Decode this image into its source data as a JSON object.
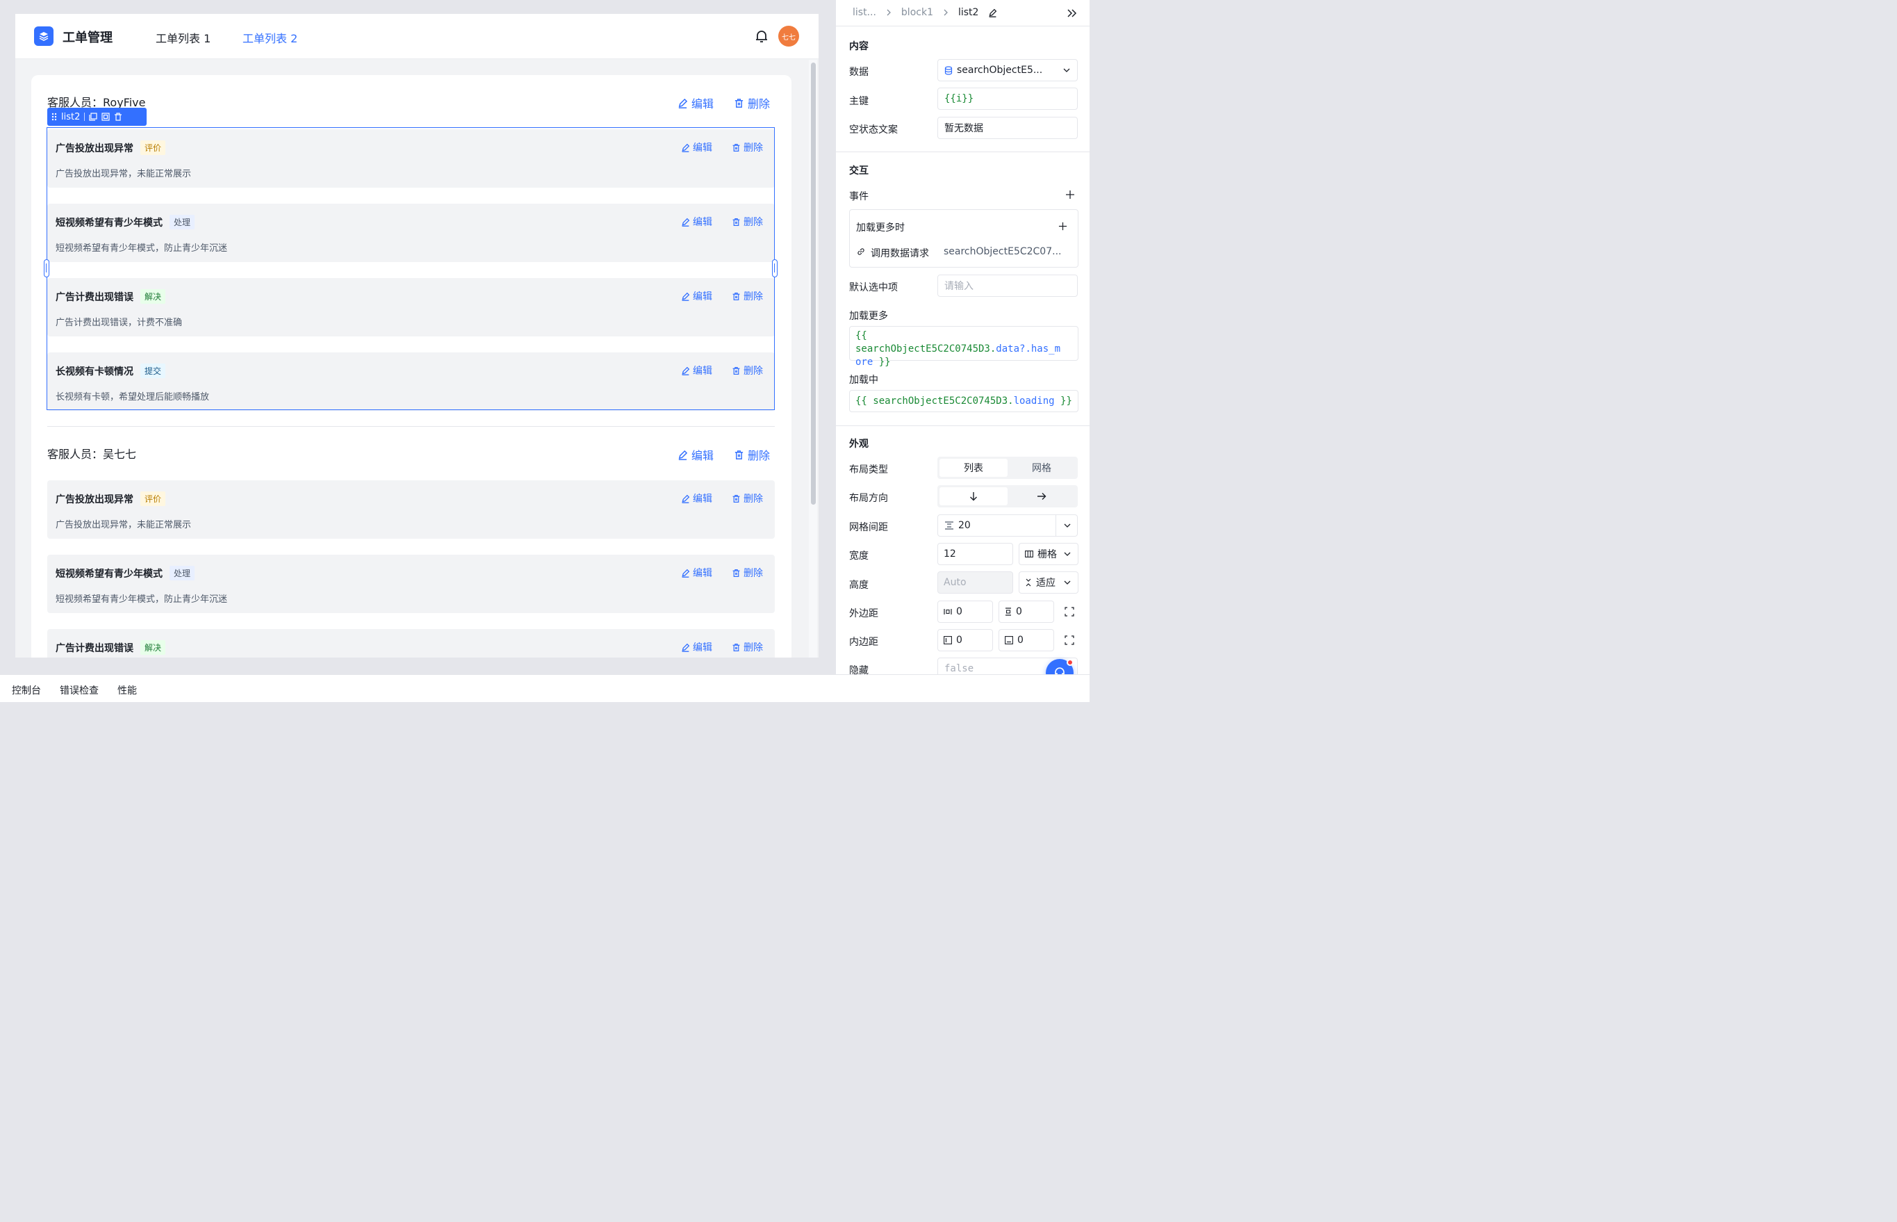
{
  "app": {
    "title": "工单管理",
    "tabs": [
      "工单列表 1",
      "工单列表 2"
    ],
    "active_tab": 1,
    "avatar_text": "七七"
  },
  "groups": [
    {
      "title": "客服人员：RoyFive",
      "edit": "编辑",
      "delete": "删除",
      "items": [
        {
          "title": "广告投放出现异常",
          "tag": "评价",
          "tag_color": "yellow",
          "desc": "广告投放出现异常，未能正常展示",
          "edit": "编辑",
          "delete": "删除"
        },
        {
          "title": "短视频希望有青少年模式",
          "tag": "处理",
          "tag_color": "blue",
          "desc": "短视频希望有青少年模式，防止青少年沉迷",
          "edit": "编辑",
          "delete": "删除"
        },
        {
          "title": "广告计费出现错误",
          "tag": "解决",
          "tag_color": "green",
          "desc": "广告计费出现错误，计费不准确",
          "edit": "编辑",
          "delete": "删除"
        },
        {
          "title": "长视频有卡顿情况",
          "tag": "提交",
          "tag_color": "cyan",
          "desc": "长视频有卡顿，希望处理后能顺畅播放",
          "edit": "编辑",
          "delete": "删除"
        }
      ]
    },
    {
      "title": "客服人员：吴七七",
      "edit": "编辑",
      "delete": "删除",
      "items": [
        {
          "title": "广告投放出现异常",
          "tag": "评价",
          "tag_color": "yellow",
          "desc": "广告投放出现异常，未能正常展示",
          "edit": "编辑",
          "delete": "删除"
        },
        {
          "title": "短视频希望有青少年模式",
          "tag": "处理",
          "tag_color": "blue",
          "desc": "短视频希望有青少年模式，防止青少年沉迷",
          "edit": "编辑",
          "delete": "删除"
        },
        {
          "title": "广告计费出现错误",
          "tag": "解决",
          "tag_color": "green",
          "desc": "",
          "edit": "编辑",
          "delete": "删除"
        }
      ]
    }
  ],
  "selection": {
    "label": "list2"
  },
  "panel": {
    "breadcrumbs": [
      "list...",
      "block1",
      "list2"
    ],
    "content": {
      "title": "内容",
      "data_label": "数据",
      "data_value": "searchObjectE5...",
      "key_label": "主键",
      "key_value": "{{i}}",
      "empty_label": "空状态文案",
      "empty_value": "暂无数据"
    },
    "interaction": {
      "title": "交互",
      "events_label": "事件",
      "event_name": "加载更多时",
      "action_label": "调用数据请求",
      "action_value": "searchObjectE5C2C07...",
      "default_sel_label": "默认选中项",
      "default_sel_placeholder": "请输入",
      "load_more_label": "加载更多",
      "load_more_code": {
        "open": "{{ searchObjectE5C2C0745D3.",
        "prop": "data?.has_m",
        "tail_prop": "ore",
        "close": " }}"
      },
      "loading_label": "加载中",
      "loading_code": {
        "open": "{{ searchObjectE5C2C0745D3.",
        "prop": "loading",
        "close": " }}"
      }
    },
    "appearance": {
      "title": "外观",
      "layout_type_label": "布局类型",
      "layout_types": [
        "列表",
        "网格"
      ],
      "layout_dir_label": "布局方向",
      "grid_gap_label": "网格间距",
      "grid_gap_value": "20",
      "width_label": "宽度",
      "width_value": "12",
      "width_unit": "栅格",
      "height_label": "高度",
      "height_placeholder": "Auto",
      "height_mode": "适应",
      "margin_label": "外边距",
      "margin_values": [
        "0",
        "0"
      ],
      "padding_label": "内边距",
      "padding_values": [
        "0",
        "0"
      ],
      "hidden_label": "隐藏",
      "hidden_value": "false"
    }
  },
  "bottom_tabs": [
    "控制台",
    "错误检查",
    "性能"
  ]
}
